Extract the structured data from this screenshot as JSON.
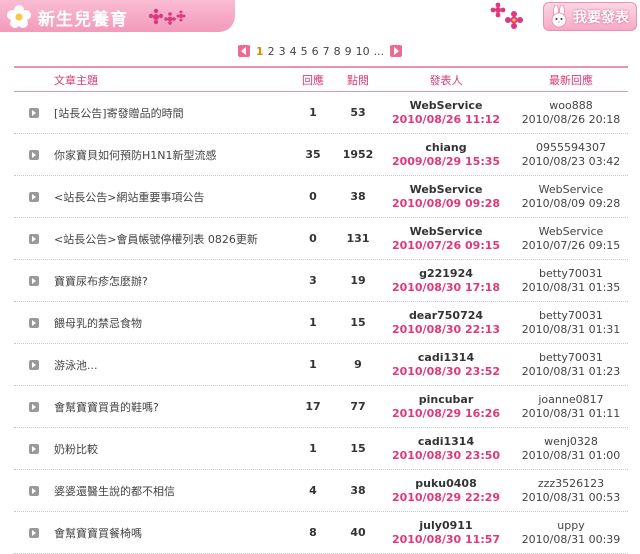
{
  "header": {
    "title": "新生兒養育",
    "post_button_label": "我要發表"
  },
  "pagination": {
    "pages": [
      "1",
      "2",
      "3",
      "4",
      "5",
      "6",
      "7",
      "8",
      "9",
      "10"
    ],
    "current": "1",
    "ellipsis": "..."
  },
  "table": {
    "columns": {
      "subject": "文章主題",
      "replies": "回應",
      "views": "點閱",
      "poster": "發表人",
      "latest": "最新回應"
    },
    "rows": [
      {
        "subject": "[站長公告]寄發贈品的時間",
        "replies": "1",
        "views": "53",
        "poster": "WebService",
        "post_time": "2010/08/26 11:12",
        "latest_user": "woo888",
        "latest_time": "2010/08/26 20:18"
      },
      {
        "subject": "你家寶貝如何預防H1N1新型流感",
        "replies": "35",
        "views": "1952",
        "poster": "chiang",
        "post_time": "2009/08/29 15:35",
        "latest_user": "0955594307",
        "latest_time": "2010/08/23 03:42"
      },
      {
        "subject": "<站長公告>網站重要事項公告",
        "replies": "0",
        "views": "38",
        "poster": "WebService",
        "post_time": "2010/08/09 09:28",
        "latest_user": "WebService",
        "latest_time": "2010/08/09 09:28"
      },
      {
        "subject": "<站長公告>會員帳號停權列表 0826更新",
        "replies": "0",
        "views": "131",
        "poster": "WebService",
        "post_time": "2010/07/26 09:15",
        "latest_user": "WebService",
        "latest_time": "2010/07/26 09:15"
      },
      {
        "subject": "寶寶尿布疹怎麼辦?",
        "replies": "3",
        "views": "19",
        "poster": "g221924",
        "post_time": "2010/08/30 17:18",
        "latest_user": "betty70031",
        "latest_time": "2010/08/31 01:35"
      },
      {
        "subject": "餵母乳的禁忌食物",
        "replies": "1",
        "views": "15",
        "poster": "dear750724",
        "post_time": "2010/08/30 22:13",
        "latest_user": "betty70031",
        "latest_time": "2010/08/31 01:31"
      },
      {
        "subject": "游泳池...",
        "replies": "1",
        "views": "9",
        "poster": "cadi1314",
        "post_time": "2010/08/30 23:52",
        "latest_user": "betty70031",
        "latest_time": "2010/08/31 01:23"
      },
      {
        "subject": "會幫寶寶買貴的鞋嗎?",
        "replies": "17",
        "views": "77",
        "poster": "pincubar",
        "post_time": "2010/08/29 16:26",
        "latest_user": "joanne0817",
        "latest_time": "2010/08/31 01:11"
      },
      {
        "subject": "奶粉比較",
        "replies": "1",
        "views": "15",
        "poster": "cadi1314",
        "post_time": "2010/08/30 23:50",
        "latest_user": "wenj0328",
        "latest_time": "2010/08/31 01:00"
      },
      {
        "subject": "婆婆還醫生說的都不相信",
        "replies": "4",
        "views": "38",
        "poster": "puku0408",
        "post_time": "2010/08/29 22:29",
        "latest_user": "zzz3526123",
        "latest_time": "2010/08/31 00:53"
      },
      {
        "subject": "會幫寶寶買餐椅嗎",
        "replies": "8",
        "views": "40",
        "poster": "july0911",
        "post_time": "2010/08/30 11:57",
        "latest_user": "uppy",
        "latest_time": "2010/08/31 00:39"
      }
    ]
  },
  "colors": {
    "accent_pink": "#e0387d",
    "header_pink": "#f39abb",
    "current_page": "#e08a00"
  },
  "icons": {
    "title_flower": "flower-icon",
    "bunny": "bunny-icon",
    "row_bullet": "triangle-bullet-icon",
    "prev": "arrow-left-icon",
    "next": "arrow-right-icon"
  }
}
